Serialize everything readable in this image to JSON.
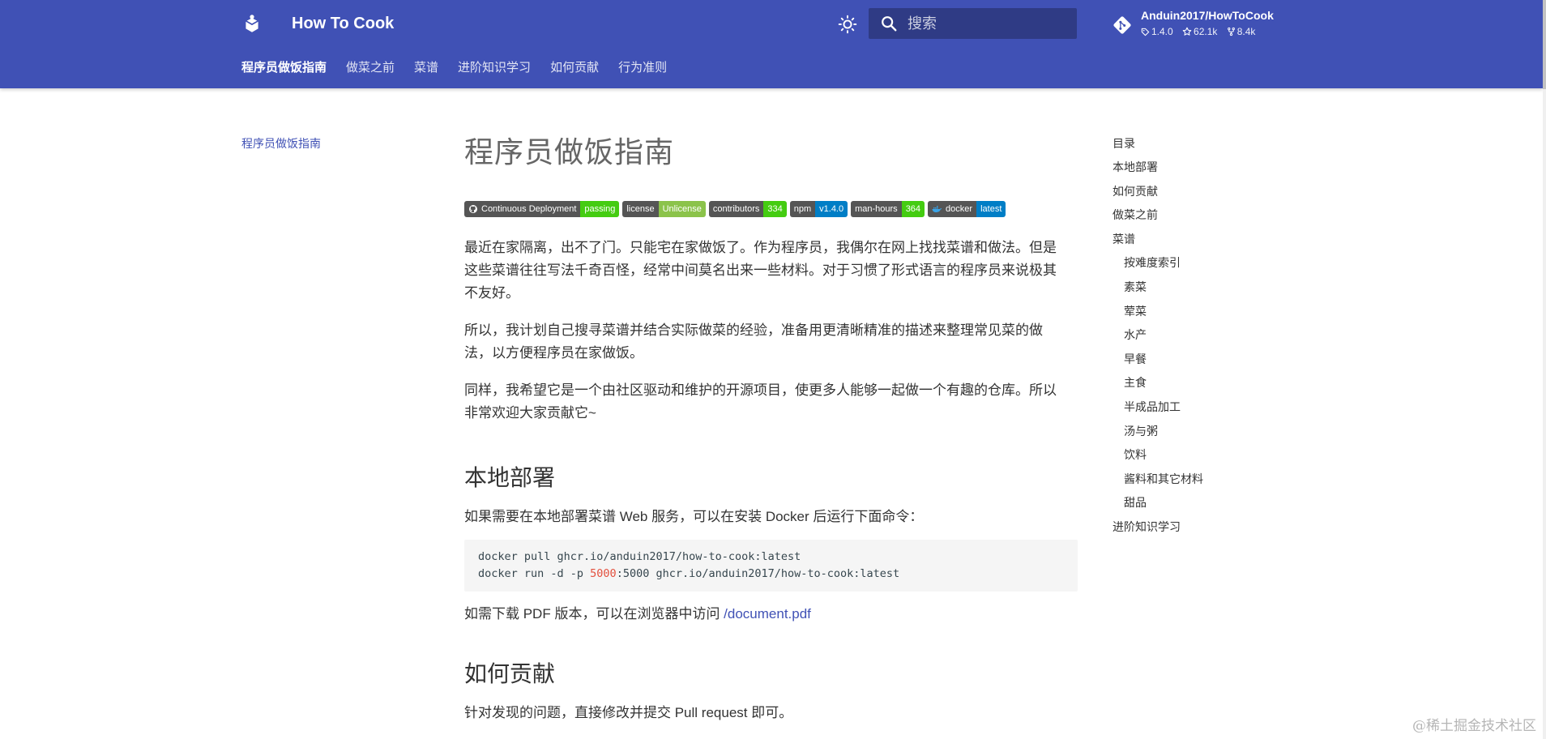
{
  "header": {
    "site_title": "How To Cook",
    "search_placeholder": "搜索",
    "repo": {
      "name": "Anduin2017/HowToCook",
      "version": "1.4.0",
      "stars": "62.1k",
      "forks": "8.4k"
    },
    "tabs": [
      "程序员做饭指南",
      "做菜之前",
      "菜谱",
      "进阶知识学习",
      "如何贡献",
      "行为准则"
    ],
    "active_tab": "程序员做饭指南"
  },
  "left_nav": {
    "item": "程序员做饭指南"
  },
  "content": {
    "title": "程序员做饭指南",
    "badges": [
      {
        "label": "Continuous Deployment",
        "value": "passing",
        "color": "#4c1"
      },
      {
        "label": "license",
        "value": "Unlicense",
        "color": "#8bc34a"
      },
      {
        "label": "contributors",
        "value": "334",
        "color": "#4c1"
      },
      {
        "label": "npm",
        "value": "v1.4.0",
        "color": "#007ec6"
      },
      {
        "label": "man-hours",
        "value": "364",
        "color": "#4c1"
      },
      {
        "label": "docker",
        "value": "latest",
        "color": "#007ec6"
      }
    ],
    "paragraphs": {
      "p1_line1": "最近在家隔离，出不了门。只能宅在家做饭了。作为程序员，我偶尔在网上找找菜谱和做法。但是",
      "p1_line2": "这些菜谱往往写法千奇百怪，经常中间莫名出来一些材料。对于习惯了形式语言的程序员来说极其",
      "p1_line3": "不友好。",
      "p2_line1": "所以，我计划自己搜寻菜谱并结合实际做菜的经验，准备用更清晰精准的描述来整理常见菜的做",
      "p2_line2": "法，以方便程序员在家做饭。",
      "p3_line1": "同样，我希望它是一个由社区驱动和维护的开源项目，使更多人能够一起做一个有趣的仓库。所以",
      "p3_line2": "非常欢迎大家贡献它~"
    },
    "section_local": {
      "heading": "本地部署",
      "intro": "如果需要在本地部署菜谱 Web 服务，可以在安装 Docker 后运行下面命令：",
      "code_line1": "docker pull ghcr.io/anduin2017/how-to-cook:latest",
      "code_line2_pre": "docker run -d -p ",
      "code_line2_num": "5000",
      "code_line2_post": ":5000 ghcr.io/anduin2017/how-to-cook:latest",
      "pdf_text": "如需下载 PDF 版本，可以在浏览器中访问 ",
      "pdf_link": "/document.pdf"
    },
    "section_contrib": {
      "heading": "如何贡献",
      "text": "针对发现的问题，直接修改并提交 Pull request 即可。"
    }
  },
  "toc": {
    "title": "目录",
    "items": [
      {
        "label": "本地部署",
        "sub": false
      },
      {
        "label": "如何贡献",
        "sub": false
      },
      {
        "label": "做菜之前",
        "sub": false
      },
      {
        "label": "菜谱",
        "sub": false
      },
      {
        "label": "按难度索引",
        "sub": true
      },
      {
        "label": "素菜",
        "sub": true
      },
      {
        "label": "荤菜",
        "sub": true
      },
      {
        "label": "水产",
        "sub": true
      },
      {
        "label": "早餐",
        "sub": true
      },
      {
        "label": "主食",
        "sub": true
      },
      {
        "label": "半成品加工",
        "sub": true
      },
      {
        "label": "汤与粥",
        "sub": true
      },
      {
        "label": "饮料",
        "sub": true
      },
      {
        "label": "酱料和其它材料",
        "sub": true
      },
      {
        "label": "甜品",
        "sub": true
      },
      {
        "label": "进阶知识学习",
        "sub": false
      }
    ]
  },
  "watermark": "@稀土掘金技术社区",
  "colors": {
    "primary": "#4051b5",
    "search_bg": "#2f3b85",
    "code_bg": "#f5f5f5",
    "code_number": "#e3503e"
  }
}
